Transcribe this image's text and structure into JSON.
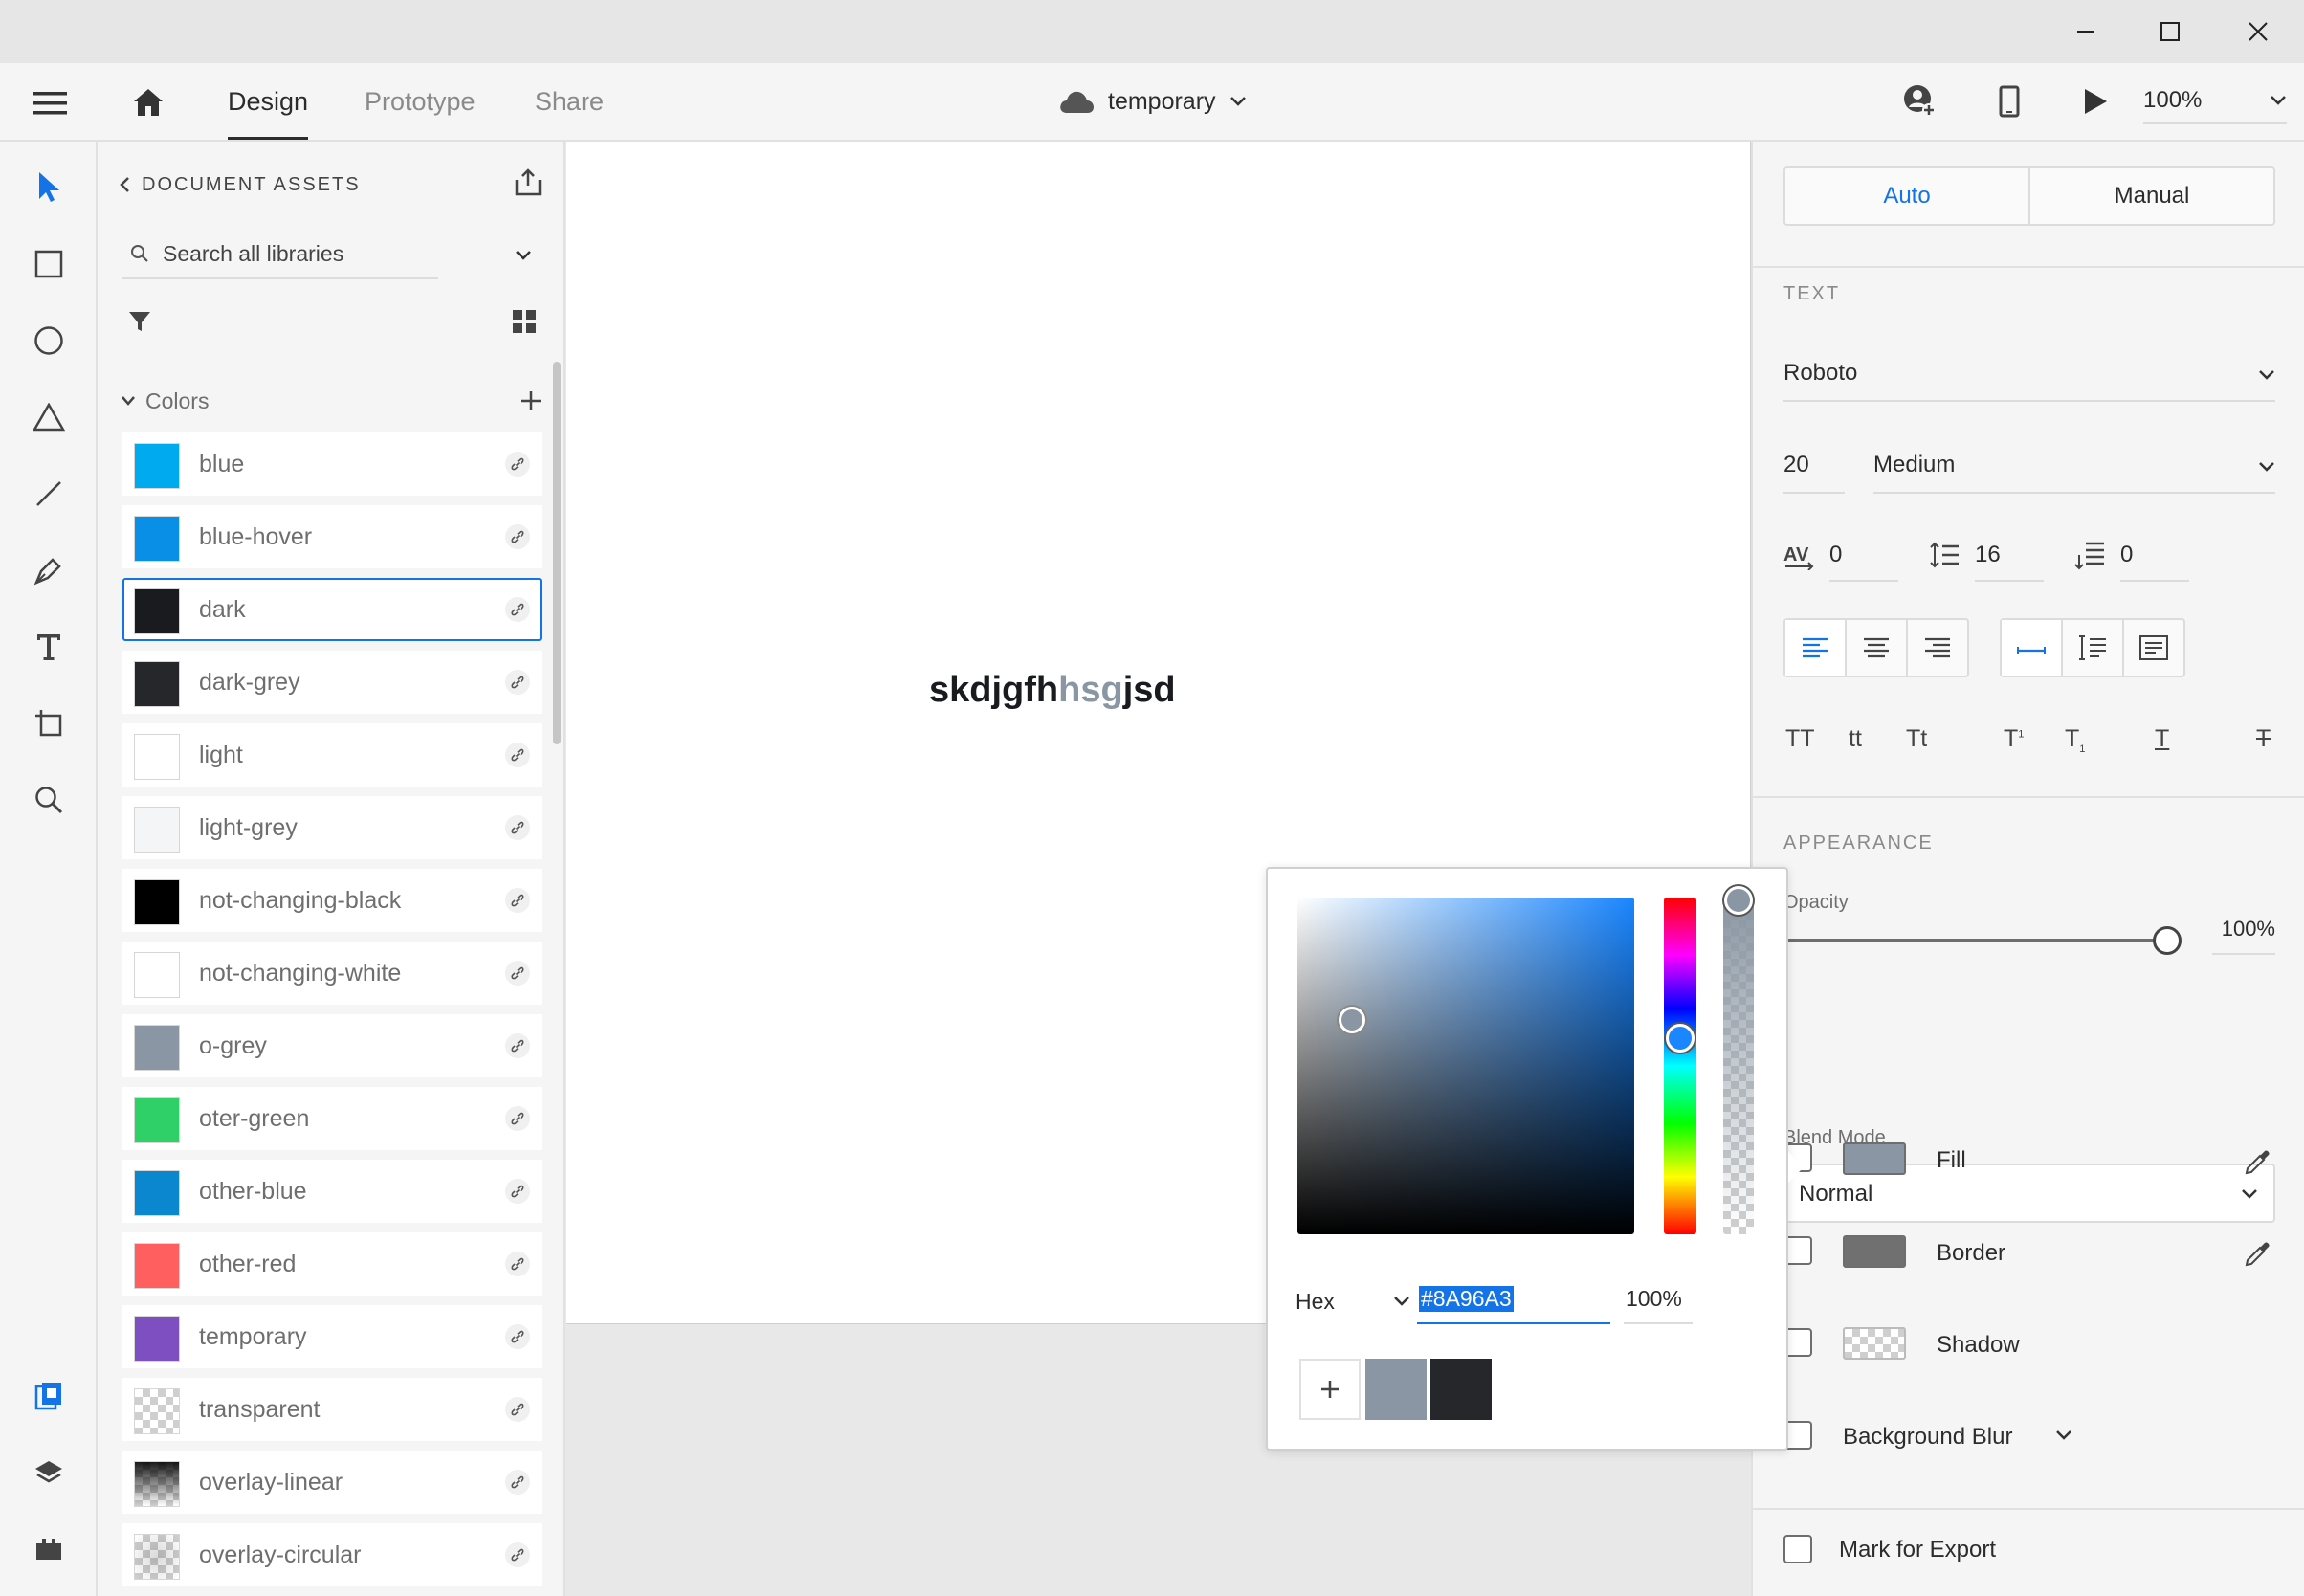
{
  "app": {
    "zoom": "100%",
    "tabs": [
      {
        "label": "Design",
        "active": true
      },
      {
        "label": "Prototype",
        "active": false
      },
      {
        "label": "Share",
        "active": false
      }
    ],
    "doc_title": "temporary"
  },
  "assets": {
    "title": "DOCUMENT ASSETS",
    "search_placeholder": "Search all libraries",
    "colors_section": "Colors",
    "colors": [
      {
        "name": "blue",
        "hex": "#00aaef"
      },
      {
        "name": "blue-hover",
        "hex": "#0a8fe6"
      },
      {
        "name": "dark",
        "hex": "#191b1f",
        "selected": true
      },
      {
        "name": "dark-grey",
        "hex": "#25272b"
      },
      {
        "name": "light",
        "hex": "#ffffff"
      },
      {
        "name": "light-grey",
        "hex": "#f4f5f7"
      },
      {
        "name": "not-changing-black",
        "hex": "#000000"
      },
      {
        "name": "not-changing-white",
        "hex": "#ffffff"
      },
      {
        "name": "o-grey",
        "hex": "#8a96a3"
      },
      {
        "name": "oter-green",
        "hex": "#2ed067"
      },
      {
        "name": "other-blue",
        "hex": "#0b87d0"
      },
      {
        "name": "other-red",
        "hex": "#ff5f5f"
      },
      {
        "name": "temporary",
        "hex": "#7d4fc0"
      },
      {
        "name": "transparent",
        "hex": "transparent"
      },
      {
        "name": "overlay-linear",
        "hex": "linear-gradient"
      },
      {
        "name": "overlay-circular",
        "hex": "radial-gradient"
      }
    ]
  },
  "canvas": {
    "text_part1": "skdjgfh",
    "text_part2": "hsg",
    "text_part3": "jsd",
    "highlight_color": "#8a96a3"
  },
  "props": {
    "mode_auto": "Auto",
    "mode_manual": "Manual",
    "text_section": "TEXT",
    "font_family": "Roboto",
    "font_size": "20",
    "font_weight": "Medium",
    "char_spacing": "0",
    "line_spacing": "16",
    "para_spacing": "0",
    "transform": {
      "upper": "TT",
      "lower": "tt",
      "title": "Tt",
      "super": "T",
      "sub": "T",
      "underline": "T",
      "strike": "T"
    },
    "appearance_section": "APPEARANCE",
    "opacity_label": "Opacity",
    "opacity_value": "100%",
    "blend_label": "Blend Mode",
    "blend_value": "Normal",
    "fill_label": "Fill",
    "border_label": "Border",
    "shadow_label": "Shadow",
    "blur_label": "Background Blur",
    "export_label": "Mark for Export",
    "fill_color": "#8a96a3",
    "border_color": "#707070"
  },
  "picker": {
    "mode": "Hex",
    "hex_value": "#8A96A3",
    "alpha": "100%",
    "swatches": [
      "#8a96a3",
      "#25272b"
    ]
  }
}
